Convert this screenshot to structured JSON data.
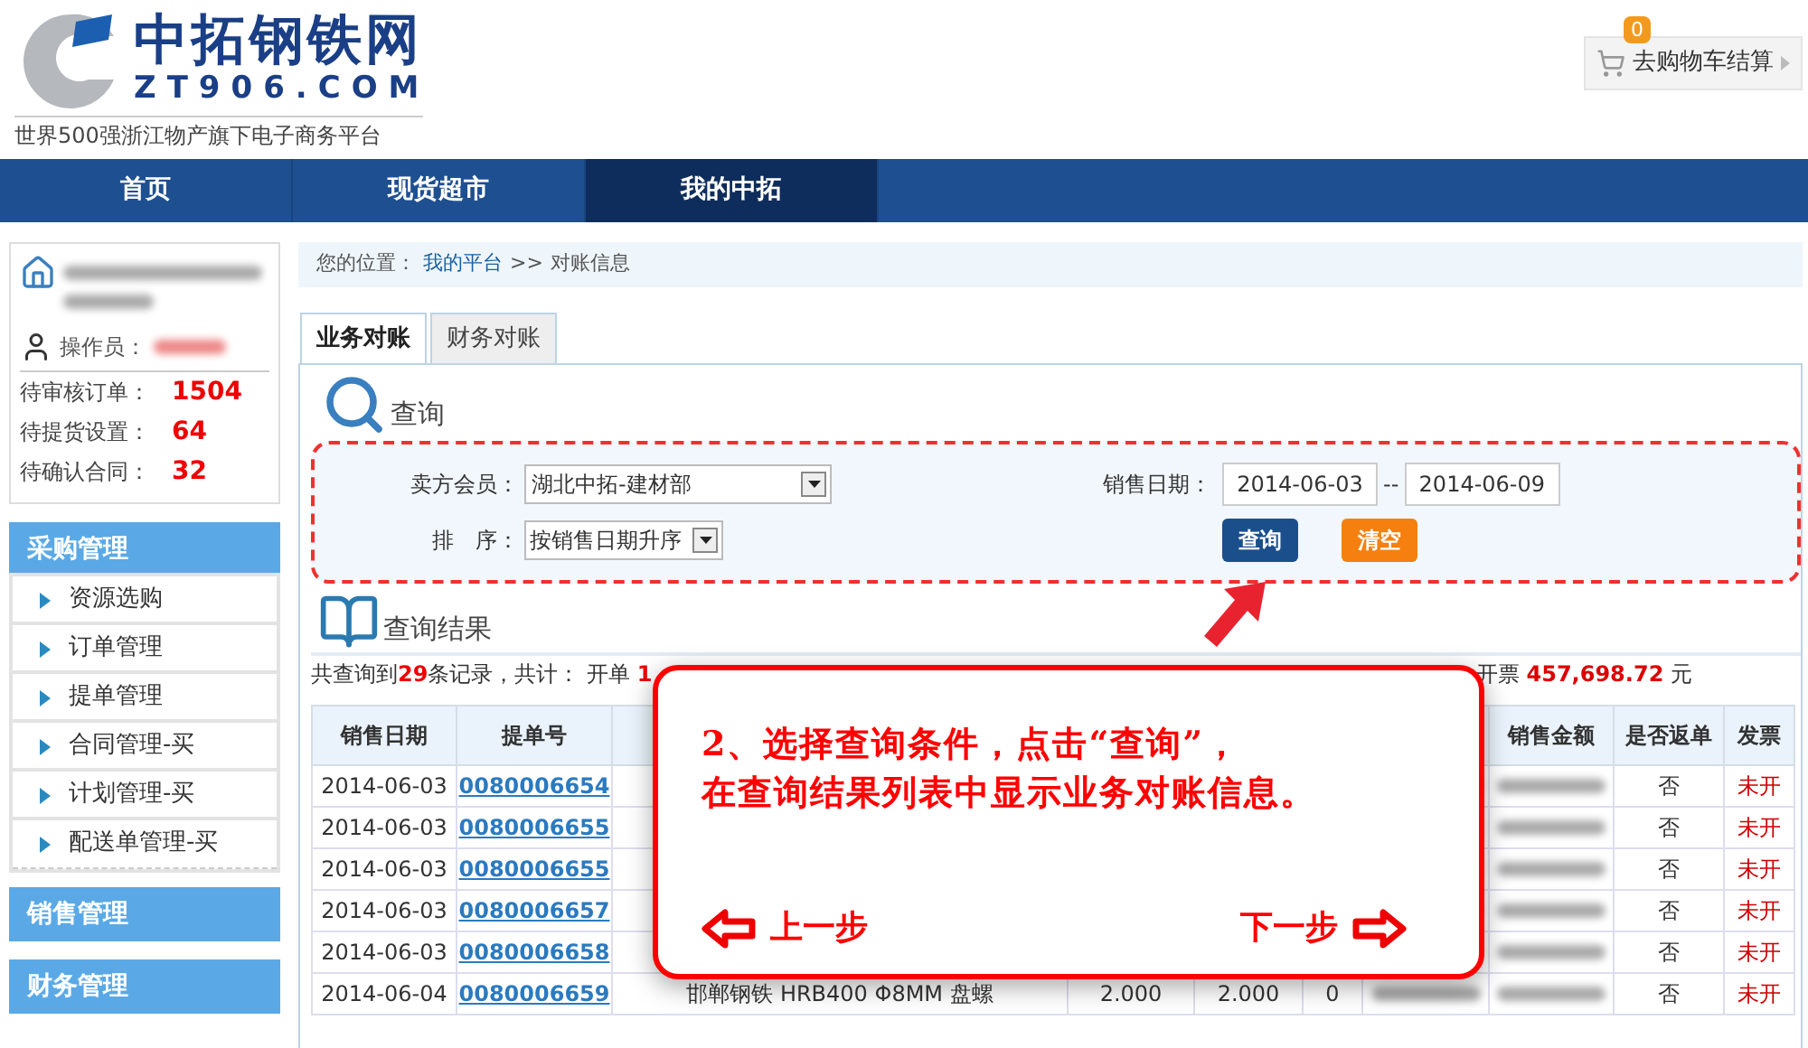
{
  "logo": {
    "name": "中拓钢铁网",
    "domain": "ZT906.COM",
    "slogan": "世界500强浙江物产旗下电子商务平台"
  },
  "cart": {
    "count": "0",
    "label": "去购物车结算"
  },
  "nav": [
    {
      "label": "首页",
      "selected": false
    },
    {
      "label": "现货超市",
      "selected": false
    },
    {
      "label": "我的中拓",
      "selected": true
    }
  ],
  "user_card": {
    "operator_label": "操作员：",
    "stats": [
      {
        "label": "待审核订单：",
        "value": "1504"
      },
      {
        "label": "待提货设置：",
        "value": "64"
      },
      {
        "label": "待确认合同：",
        "value": "32"
      }
    ]
  },
  "sidebar": [
    {
      "title": "采购管理",
      "items": [
        "资源选购",
        "订单管理",
        "提单管理",
        "合同管理-买",
        "计划管理-买",
        "配送单管理-买"
      ]
    },
    {
      "title": "销售管理"
    },
    {
      "title": "财务管理"
    }
  ],
  "breadcrumb": {
    "label": "您的位置：",
    "link": "我的平台",
    "separator": ">>",
    "current": "对账信息"
  },
  "tabs": [
    {
      "label": "业务对账",
      "selected": true
    },
    {
      "label": "财务对账",
      "selected": false
    }
  ],
  "query": {
    "title": "查询",
    "member_label": "卖方会员：",
    "member_value": "湖北中拓-建材部",
    "sort_label": "排　序：",
    "sort_value": "按销售日期升序",
    "date_label": "销售日期：",
    "date_from": "2014-06-03",
    "date_sep": "--",
    "date_to": "2014-06-09",
    "buttons": [
      {
        "label": "查询",
        "kind": "primary"
      },
      {
        "label": "清空",
        "kind": "secondary"
      }
    ]
  },
  "results": {
    "title": "查询结果",
    "summary_left": [
      {
        "text": "共查询到",
        "emph": false
      },
      {
        "text": "29",
        "emph": true
      },
      {
        "text": "条记录，共计：  开单 ",
        "emph": false
      },
      {
        "text": "1",
        "emph": true
      }
    ],
    "summary_right": [
      {
        "text": "开票 ",
        "emph": false
      },
      {
        "text": "457,698.72",
        "emph": true
      },
      {
        "text": " 元",
        "emph": false
      }
    ],
    "columns_left": [
      "销售日期",
      "提单号"
    ],
    "columns_right": [
      "销售金额",
      "是否返单",
      "发票"
    ],
    "rows": [
      {
        "date": "2014-06-03",
        "bill_no": "0080006654",
        "returned": "否",
        "invoice": "未开"
      },
      {
        "date": "2014-06-03",
        "bill_no": "0080006655",
        "returned": "否",
        "invoice": "未开"
      },
      {
        "date": "2014-06-03",
        "bill_no": "0080006655",
        "returned": "否",
        "invoice": "未开"
      },
      {
        "date": "2014-06-03",
        "bill_no": "0080006657",
        "returned": "否",
        "invoice": "未开"
      },
      {
        "date": "2014-06-03",
        "bill_no": "0080006658",
        "returned": "否",
        "invoice": "未开"
      },
      {
        "date": "2014-06-04",
        "bill_no": "0080006659",
        "product": "邯郸钢铁 HRB400 Φ8MM 盘螺",
        "qty_1": "2.000",
        "qty_2": "2.000",
        "column_6": "0",
        "returned": "否",
        "invoice": "未开"
      }
    ]
  },
  "tip": {
    "lines": [
      "2、选择查询条件，点击“查询”，",
      "在查询结果列表中显示业务对账信息。"
    ],
    "prev": "上一步",
    "next": "下一步"
  }
}
